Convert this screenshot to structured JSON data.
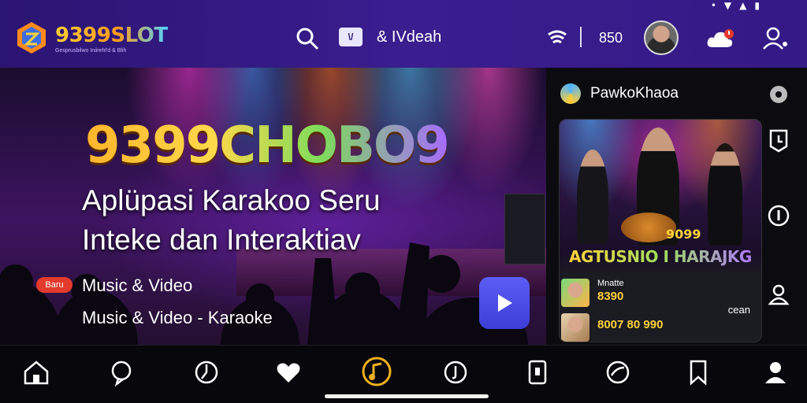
{
  "header": {
    "brand": "9399SLOT",
    "tagline": "Gesprusbilwo Iniirehl'd & Blih",
    "video_label": "& IVdeah",
    "video_badge": "\\/",
    "count": "850"
  },
  "hero": {
    "title": "9399CHOBO9",
    "subtitle_line1": "Aplüpasi Karakoo Seru",
    "subtitle_line2": "Inteke dan Interaktiav",
    "badge": "Baru",
    "category": "Music & Video",
    "category_full": "Music & Video - Karaoke"
  },
  "panel": {
    "title": "PawkoKhaoa",
    "card_brand": "9099",
    "card_headline": "AGTUSNIO I HARAJKG",
    "rows": [
      {
        "name": "Mnatte",
        "value": "8390",
        "extra": ""
      },
      {
        "name": "",
        "value": "8007 80 990",
        "extra": "cean"
      }
    ]
  },
  "nav": [
    "home",
    "chat",
    "clock",
    "heart",
    "music",
    "tiktok",
    "phone",
    "chart",
    "bookmark",
    "profile"
  ]
}
